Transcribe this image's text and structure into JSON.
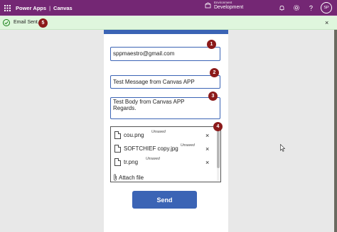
{
  "topbar": {
    "app_name": "Power Apps",
    "separator": "|",
    "section": "Canvas",
    "environment_label": "Environment",
    "environment_name": "Development",
    "avatar_initials": "SP",
    "color": "#742774"
  },
  "notification": {
    "message": "Email Sent.",
    "close": "×",
    "color": "#dff6dd"
  },
  "form": {
    "to_value": "sppmaestro@gmail.com",
    "subject_value": "Test Message from Canvas APP",
    "body_value": "Test Body from Canvas APP\nRegards.",
    "accent": "#3b64b5",
    "attachments": [
      {
        "name": "cou.png",
        "status": "Unsaved",
        "remove": "×"
      },
      {
        "name": "SOFTCHIEF copy.jpg",
        "status": "Unsaved",
        "remove": "×"
      },
      {
        "name": "tr.png",
        "status": "Unsaved",
        "remove": "×"
      }
    ],
    "attach_label": "Attach file",
    "send_label": "Send"
  },
  "badges": {
    "to": "1",
    "subject": "2",
    "body": "3",
    "attachments": "4",
    "notification": "5",
    "color": "#8b1a1a"
  },
  "icons": [
    "waffle-icon",
    "environment-icon",
    "bell-icon",
    "gear-icon",
    "help-icon",
    "check-circle-icon",
    "file-icon",
    "paperclip-icon",
    "close-icon"
  ]
}
